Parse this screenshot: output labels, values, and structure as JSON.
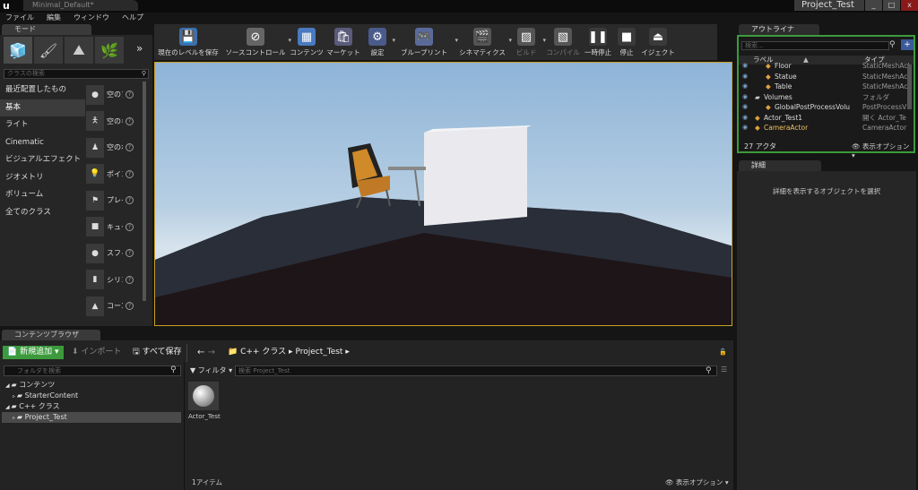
{
  "window": {
    "doc_tab": "Minimal_Default*",
    "project_name": "Project_Test",
    "controls": [
      "_",
      "□",
      "x"
    ]
  },
  "menu": [
    "ファイル",
    "編集",
    "ウィンドウ",
    "ヘルプ"
  ],
  "modes": {
    "tab_label": "モード",
    "search_placeholder": "クラスの検索",
    "categories": [
      {
        "label": "最近配置したもの",
        "selected": false
      },
      {
        "label": "基本",
        "selected": true
      },
      {
        "label": "ライト",
        "selected": false
      },
      {
        "label": "Cinematic",
        "selected": false
      },
      {
        "label": "ビジュアルエフェクト",
        "selected": false
      },
      {
        "label": "ジオメトリ",
        "selected": false
      },
      {
        "label": "ボリューム",
        "selected": false
      },
      {
        "label": "全てのクラス",
        "selected": false
      }
    ],
    "placeables": [
      {
        "label": "空のア",
        "icon": "sphere-icon"
      },
      {
        "label": "空のキ",
        "icon": "character-icon"
      },
      {
        "label": "空のボ",
        "icon": "pawn-icon"
      },
      {
        "label": "ポイン",
        "icon": "point-light-icon"
      },
      {
        "label": "プレイ",
        "icon": "player-start-icon"
      },
      {
        "label": "キュー",
        "icon": "cube-icon"
      },
      {
        "label": "スフィ",
        "icon": "sphere-icon"
      },
      {
        "label": "シリン",
        "icon": "cylinder-icon"
      },
      {
        "label": "コーン",
        "icon": "cone-icon"
      }
    ],
    "help_glyph": "?"
  },
  "toolbar": [
    {
      "label": "現在のレベルを保存",
      "icon": "save-icon",
      "color": "#3a6fb0",
      "dropdown": false,
      "disabled": false
    },
    {
      "label": "ソースコントロール",
      "icon": "source-control-icon",
      "color": "#666666",
      "dropdown": true,
      "disabled": false
    },
    {
      "label": "コンテンツ",
      "icon": "content-icon",
      "color": "#4a7ac0",
      "dropdown": false,
      "disabled": false
    },
    {
      "label": "マーケット",
      "icon": "marketplace-icon",
      "color": "#5a5a7a",
      "dropdown": false,
      "disabled": false
    },
    {
      "label": "設定",
      "icon": "settings-icon",
      "color": "#4a5a8a",
      "dropdown": true,
      "disabled": false
    },
    {
      "label": "ブループリント",
      "icon": "blueprint-icon",
      "color": "#5a6a9a",
      "dropdown": true,
      "disabled": false
    },
    {
      "label": "シネマティクス",
      "icon": "cinematics-icon",
      "color": "#555555",
      "dropdown": true,
      "disabled": false
    },
    {
      "label": "ビルド",
      "icon": "build-icon",
      "color": "#555555",
      "dropdown": true,
      "disabled": true
    },
    {
      "label": "コンパイル",
      "icon": "compile-icon",
      "color": "#555555",
      "dropdown": false,
      "disabled": true
    },
    {
      "label": "一時停止",
      "icon": "pause-icon",
      "color": "#3a3a3a",
      "dropdown": false,
      "disabled": false
    },
    {
      "label": "停止",
      "icon": "stop-icon",
      "color": "#3a3a3a",
      "dropdown": false,
      "disabled": false
    },
    {
      "label": "イジェクト",
      "icon": "eject-icon",
      "color": "#3a3a3a",
      "dropdown": false,
      "disabled": false
    }
  ],
  "outliner": {
    "tab_label": "アウトライナ",
    "search_placeholder": "検索...",
    "add_glyph": "+",
    "col_label": "ラベル",
    "col_type": "タイプ",
    "rows": [
      {
        "label": "Floor",
        "type": "StaticMeshAct",
        "level": 2,
        "folder": false
      },
      {
        "label": "Statue",
        "type": "StaticMeshAct",
        "level": 2,
        "folder": false
      },
      {
        "label": "Table",
        "type": "StaticMeshAct",
        "level": 2,
        "folder": false
      },
      {
        "label": "Volumes",
        "type": "フォルダ",
        "level": 1,
        "folder": true
      },
      {
        "label": "GlobalPostProcessVolu",
        "type": "PostProcessV",
        "level": 2,
        "folder": false
      },
      {
        "label": "Actor_Test1",
        "type": "開く Actor_Te",
        "level": 1,
        "folder": false
      },
      {
        "label": "CameraActor",
        "type": "CameraActor",
        "level": 1,
        "folder": false,
        "highlight": true
      }
    ],
    "actor_count": "27 アクタ",
    "view_options": "表示オプション"
  },
  "details": {
    "tab_label": "詳細",
    "empty_message": "詳細を表示するオブジェクトを選択"
  },
  "content_browser": {
    "tab_label": "コンテンツブラウザ",
    "new_button": "新規追加",
    "import_button": "インポート",
    "save_all_button": "すべて保存",
    "path": [
      "C++ クラス",
      "Project_Test"
    ],
    "folder_search_placeholder": "フォルダを検索",
    "filter_label": "フィルタ",
    "asset_search_placeholder": "検索 Project_Test",
    "tree": [
      {
        "label": "コンテンツ",
        "level": 0,
        "expanded": true,
        "selected": false
      },
      {
        "label": "StarterContent",
        "level": 1,
        "expanded": false,
        "selected": false
      },
      {
        "label": "C++ クラス",
        "level": 0,
        "expanded": true,
        "selected": false
      },
      {
        "label": "Project_Test",
        "level": 1,
        "expanded": false,
        "selected": true
      }
    ],
    "assets": [
      {
        "name": "Actor_Test"
      }
    ],
    "item_count": "1アイテム",
    "view_options": "表示オプション"
  }
}
